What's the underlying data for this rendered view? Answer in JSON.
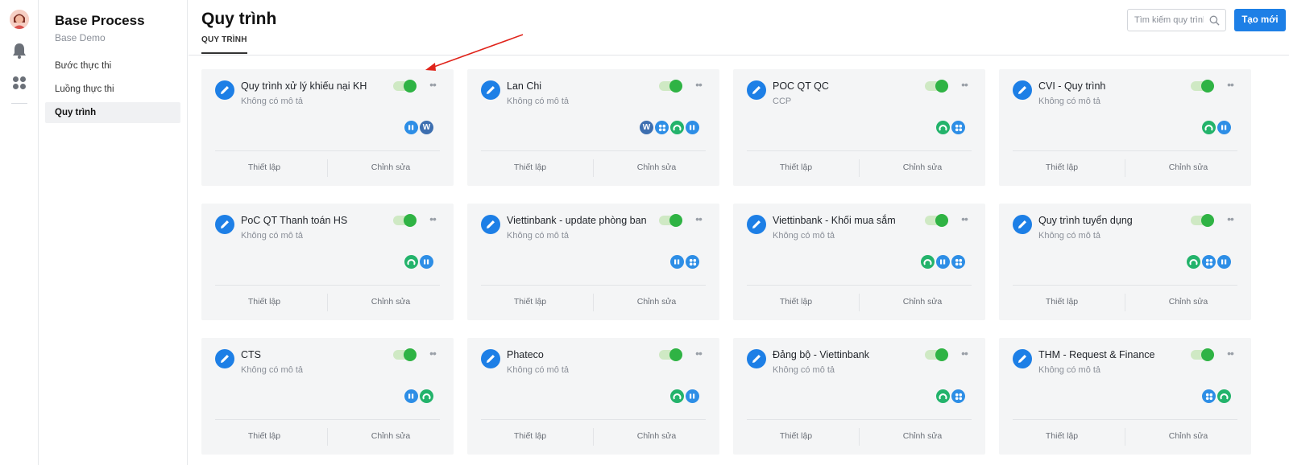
{
  "sidebar": {
    "title": "Base Process",
    "subtitle": "Base Demo",
    "items": [
      {
        "label": "Bước thực thi",
        "active": false
      },
      {
        "label": "Luồng thực thi",
        "active": false
      },
      {
        "label": "Quy trình",
        "active": true
      }
    ]
  },
  "header": {
    "title": "Quy trình",
    "tab": "QUY TRÌNH",
    "search_placeholder": "Tìm kiếm quy trình",
    "new_button": "Tạo mới"
  },
  "card_actions": {
    "setup": "Thiết lập",
    "edit": "Chỉnh sửa"
  },
  "colors": {
    "accent": "#1d7fe6",
    "toggle_on": "#2fb344",
    "annotation_arrow": "#e0241b"
  },
  "processes": [
    {
      "name": "Quy trình xử lý khiếu nại KH",
      "desc": "Không có mô tả",
      "enabled": true,
      "apps": [
        "bar-app-icon",
        "wiki-app-icon"
      ]
    },
    {
      "name": "Lan Chi",
      "desc": "Không có mô tả",
      "enabled": true,
      "apps": [
        "wiki-app-icon",
        "grid-app-icon",
        "ring-app-icon",
        "bar-app-icon"
      ]
    },
    {
      "name": "POC QT QC",
      "desc": "CCP",
      "enabled": true,
      "apps": [
        "ring-app-icon",
        "grid-app-icon"
      ]
    },
    {
      "name": "CVI - Quy trình",
      "desc": "Không có mô tả",
      "enabled": true,
      "apps": [
        "ring-app-icon",
        "bar-app-icon"
      ]
    },
    {
      "name": "PoC QT Thanh toán HS",
      "desc": "Không có mô tả",
      "enabled": true,
      "apps": [
        "ring-app-icon",
        "bar-app-icon"
      ]
    },
    {
      "name": "Viettinbank - update phòng ban",
      "desc": "Không có mô tả",
      "enabled": true,
      "apps": [
        "bar-app-icon",
        "grid-app-icon"
      ]
    },
    {
      "name": "Viettinbank - Khối mua sắm",
      "desc": "Không có mô tả",
      "enabled": true,
      "apps": [
        "ring-app-icon",
        "bar-app-icon",
        "grid-app-icon"
      ]
    },
    {
      "name": "Quy trình tuyển dụng",
      "desc": "Không có mô tả",
      "enabled": true,
      "apps": [
        "ring-app-icon",
        "grid-app-icon",
        "bar-app-icon"
      ]
    },
    {
      "name": "CTS",
      "desc": "Không có mô tả",
      "enabled": true,
      "apps": [
        "bar-app-icon",
        "ring-app-icon"
      ]
    },
    {
      "name": "Phateco",
      "desc": "Không có mô tả",
      "enabled": true,
      "apps": [
        "ring-app-icon",
        "bar-app-icon"
      ]
    },
    {
      "name": "Đảng bộ - Viettinbank",
      "desc": "Không có mô tả",
      "enabled": true,
      "apps": [
        "ring-app-icon",
        "grid-app-icon"
      ]
    },
    {
      "name": "THM - Request & Finance",
      "desc": "Không có mô tả",
      "enabled": true,
      "apps": [
        "grid-app-icon",
        "ring-app-icon"
      ]
    }
  ]
}
